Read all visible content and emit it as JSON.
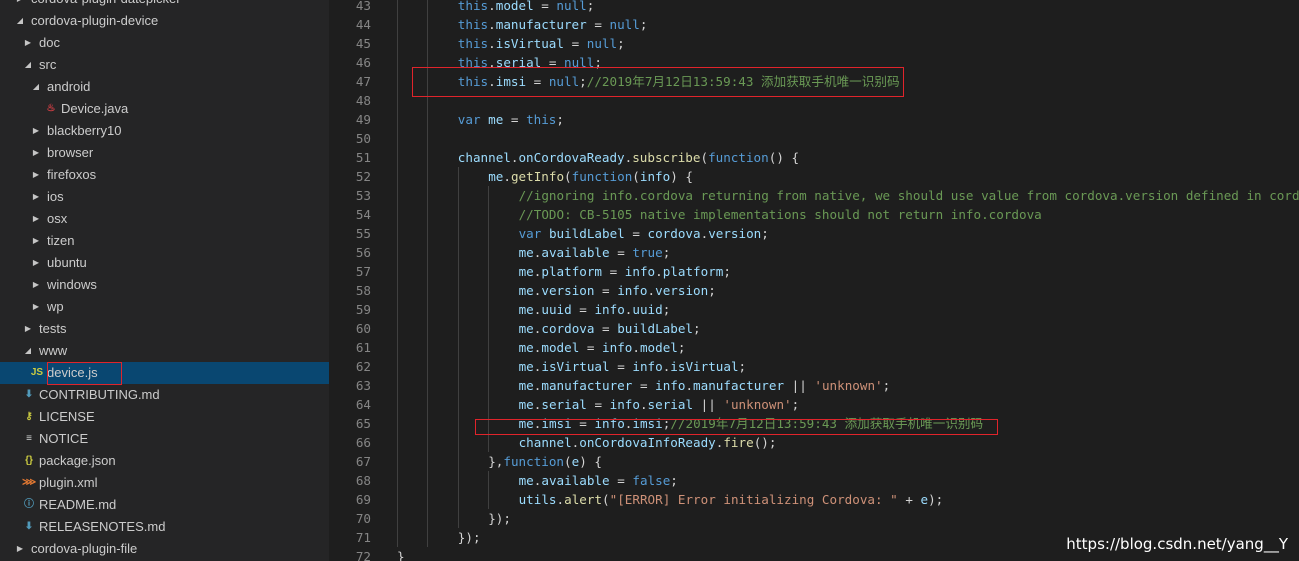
{
  "colors": {
    "sidebar_bg": "#252526",
    "editor_bg": "#1e1e1e",
    "selection": "#094771",
    "highlight_box": "#e0242b",
    "keyword": "#569cd6",
    "property": "#9cdcfe",
    "function": "#dcdcaa",
    "string": "#ce9178",
    "comment": "#6a9955"
  },
  "explorer": {
    "items": [
      {
        "label": "cordova-plugin-datepicker",
        "depth": 0,
        "twisty": "collapsed",
        "icon": ""
      },
      {
        "label": "cordova-plugin-device",
        "depth": 0,
        "twisty": "expanded",
        "icon": ""
      },
      {
        "label": "doc",
        "depth": 1,
        "twisty": "collapsed",
        "icon": ""
      },
      {
        "label": "src",
        "depth": 1,
        "twisty": "expanded",
        "icon": ""
      },
      {
        "label": "android",
        "depth": 2,
        "twisty": "expanded",
        "icon": ""
      },
      {
        "label": "Device.java",
        "depth": 3,
        "twisty": "none",
        "icon": "java-file-icon"
      },
      {
        "label": "blackberry10",
        "depth": 2,
        "twisty": "collapsed",
        "icon": ""
      },
      {
        "label": "browser",
        "depth": 2,
        "twisty": "collapsed",
        "icon": ""
      },
      {
        "label": "firefoxos",
        "depth": 2,
        "twisty": "collapsed",
        "icon": ""
      },
      {
        "label": "ios",
        "depth": 2,
        "twisty": "collapsed",
        "icon": ""
      },
      {
        "label": "osx",
        "depth": 2,
        "twisty": "collapsed",
        "icon": ""
      },
      {
        "label": "tizen",
        "depth": 2,
        "twisty": "collapsed",
        "icon": ""
      },
      {
        "label": "ubuntu",
        "depth": 2,
        "twisty": "collapsed",
        "icon": ""
      },
      {
        "label": "windows",
        "depth": 2,
        "twisty": "collapsed",
        "icon": ""
      },
      {
        "label": "wp",
        "depth": 2,
        "twisty": "collapsed",
        "icon": ""
      },
      {
        "label": "tests",
        "depth": 1,
        "twisty": "collapsed",
        "icon": ""
      },
      {
        "label": "www",
        "depth": 1,
        "twisty": "expanded",
        "icon": ""
      },
      {
        "label": "device.js",
        "depth": 2,
        "twisty": "none",
        "icon": "js-file-icon",
        "selected": true
      },
      {
        "label": "CONTRIBUTING.md",
        "depth": 1,
        "twisty": "none",
        "icon": "markdown-file-icon"
      },
      {
        "label": "LICENSE",
        "depth": 1,
        "twisty": "none",
        "icon": "license-file-icon"
      },
      {
        "label": "NOTICE",
        "depth": 1,
        "twisty": "none",
        "icon": "text-file-icon"
      },
      {
        "label": "package.json",
        "depth": 1,
        "twisty": "none",
        "icon": "json-file-icon"
      },
      {
        "label": "plugin.xml",
        "depth": 1,
        "twisty": "none",
        "icon": "xml-file-icon"
      },
      {
        "label": "README.md",
        "depth": 1,
        "twisty": "none",
        "icon": "info-file-icon"
      },
      {
        "label": "RELEASENOTES.md",
        "depth": 1,
        "twisty": "none",
        "icon": "markdown-file-icon"
      },
      {
        "label": "cordova-plugin-file",
        "depth": 0,
        "twisty": "collapsed",
        "icon": ""
      }
    ]
  },
  "editor": {
    "lines": [
      {
        "n": "43",
        "indent": 2,
        "t": [
          [
            "kw",
            "this"
          ],
          [
            "pl",
            "."
          ],
          [
            "prop",
            "model"
          ],
          [
            "pl",
            " = "
          ],
          [
            "kw",
            "null"
          ],
          [
            "pl",
            ";"
          ]
        ]
      },
      {
        "n": "44",
        "indent": 2,
        "t": [
          [
            "kw",
            "this"
          ],
          [
            "pl",
            "."
          ],
          [
            "prop",
            "manufacturer"
          ],
          [
            "pl",
            " = "
          ],
          [
            "kw",
            "null"
          ],
          [
            "pl",
            ";"
          ]
        ]
      },
      {
        "n": "45",
        "indent": 2,
        "t": [
          [
            "kw",
            "this"
          ],
          [
            "pl",
            "."
          ],
          [
            "prop",
            "isVirtual"
          ],
          [
            "pl",
            " = "
          ],
          [
            "kw",
            "null"
          ],
          [
            "pl",
            ";"
          ]
        ]
      },
      {
        "n": "46",
        "indent": 2,
        "t": [
          [
            "kw",
            "this"
          ],
          [
            "pl",
            "."
          ],
          [
            "prop",
            "serial"
          ],
          [
            "pl",
            " = "
          ],
          [
            "kw",
            "null"
          ],
          [
            "pl",
            ";"
          ]
        ]
      },
      {
        "n": "47",
        "indent": 2,
        "t": [
          [
            "kw",
            "this"
          ],
          [
            "pl",
            "."
          ],
          [
            "prop",
            "imsi"
          ],
          [
            "pl",
            " = "
          ],
          [
            "kw",
            "null"
          ],
          [
            "pl",
            ";"
          ],
          [
            "com",
            "//2019年7月12日13:59:43 添加获取手机唯一识别码"
          ]
        ]
      },
      {
        "n": "48",
        "indent": 2,
        "t": []
      },
      {
        "n": "49",
        "indent": 2,
        "t": [
          [
            "kw",
            "var"
          ],
          [
            "pl",
            " "
          ],
          [
            "prop",
            "me"
          ],
          [
            "pl",
            " = "
          ],
          [
            "kw",
            "this"
          ],
          [
            "pl",
            ";"
          ]
        ]
      },
      {
        "n": "50",
        "indent": 2,
        "t": []
      },
      {
        "n": "51",
        "indent": 2,
        "t": [
          [
            "prop",
            "channel"
          ],
          [
            "pl",
            "."
          ],
          [
            "prop",
            "onCordovaReady"
          ],
          [
            "pl",
            "."
          ],
          [
            "fn",
            "subscribe"
          ],
          [
            "pl",
            "("
          ],
          [
            "kw",
            "function"
          ],
          [
            "pl",
            "() {"
          ]
        ]
      },
      {
        "n": "52",
        "indent": 3,
        "t": [
          [
            "prop",
            "me"
          ],
          [
            "pl",
            "."
          ],
          [
            "fn",
            "getInfo"
          ],
          [
            "pl",
            "("
          ],
          [
            "kw",
            "function"
          ],
          [
            "pl",
            "("
          ],
          [
            "prop",
            "info"
          ],
          [
            "pl",
            ") {"
          ]
        ]
      },
      {
        "n": "53",
        "indent": 4,
        "t": [
          [
            "com",
            "//ignoring info.cordova returning from native, we should use value from cordova.version defined in cordova.js"
          ]
        ]
      },
      {
        "n": "54",
        "indent": 4,
        "t": [
          [
            "com",
            "//TODO: CB-5105 native implementations should not return info.cordova"
          ]
        ]
      },
      {
        "n": "55",
        "indent": 4,
        "t": [
          [
            "kw",
            "var"
          ],
          [
            "pl",
            " "
          ],
          [
            "prop",
            "buildLabel"
          ],
          [
            "pl",
            " = "
          ],
          [
            "prop",
            "cordova"
          ],
          [
            "pl",
            "."
          ],
          [
            "prop",
            "version"
          ],
          [
            "pl",
            ";"
          ]
        ]
      },
      {
        "n": "56",
        "indent": 4,
        "t": [
          [
            "prop",
            "me"
          ],
          [
            "pl",
            "."
          ],
          [
            "prop",
            "available"
          ],
          [
            "pl",
            " = "
          ],
          [
            "kw",
            "true"
          ],
          [
            "pl",
            ";"
          ]
        ]
      },
      {
        "n": "57",
        "indent": 4,
        "t": [
          [
            "prop",
            "me"
          ],
          [
            "pl",
            "."
          ],
          [
            "prop",
            "platform"
          ],
          [
            "pl",
            " = "
          ],
          [
            "prop",
            "info"
          ],
          [
            "pl",
            "."
          ],
          [
            "prop",
            "platform"
          ],
          [
            "pl",
            ";"
          ]
        ]
      },
      {
        "n": "58",
        "indent": 4,
        "t": [
          [
            "prop",
            "me"
          ],
          [
            "pl",
            "."
          ],
          [
            "prop",
            "version"
          ],
          [
            "pl",
            " = "
          ],
          [
            "prop",
            "info"
          ],
          [
            "pl",
            "."
          ],
          [
            "prop",
            "version"
          ],
          [
            "pl",
            ";"
          ]
        ]
      },
      {
        "n": "59",
        "indent": 4,
        "t": [
          [
            "prop",
            "me"
          ],
          [
            "pl",
            "."
          ],
          [
            "prop",
            "uuid"
          ],
          [
            "pl",
            " = "
          ],
          [
            "prop",
            "info"
          ],
          [
            "pl",
            "."
          ],
          [
            "prop",
            "uuid"
          ],
          [
            "pl",
            ";"
          ]
        ]
      },
      {
        "n": "60",
        "indent": 4,
        "t": [
          [
            "prop",
            "me"
          ],
          [
            "pl",
            "."
          ],
          [
            "prop",
            "cordova"
          ],
          [
            "pl",
            " = "
          ],
          [
            "prop",
            "buildLabel"
          ],
          [
            "pl",
            ";"
          ]
        ]
      },
      {
        "n": "61",
        "indent": 4,
        "t": [
          [
            "prop",
            "me"
          ],
          [
            "pl",
            "."
          ],
          [
            "prop",
            "model"
          ],
          [
            "pl",
            " = "
          ],
          [
            "prop",
            "info"
          ],
          [
            "pl",
            "."
          ],
          [
            "prop",
            "model"
          ],
          [
            "pl",
            ";"
          ]
        ]
      },
      {
        "n": "62",
        "indent": 4,
        "t": [
          [
            "prop",
            "me"
          ],
          [
            "pl",
            "."
          ],
          [
            "prop",
            "isVirtual"
          ],
          [
            "pl",
            " = "
          ],
          [
            "prop",
            "info"
          ],
          [
            "pl",
            "."
          ],
          [
            "prop",
            "isVirtual"
          ],
          [
            "pl",
            ";"
          ]
        ]
      },
      {
        "n": "63",
        "indent": 4,
        "t": [
          [
            "prop",
            "me"
          ],
          [
            "pl",
            "."
          ],
          [
            "prop",
            "manufacturer"
          ],
          [
            "pl",
            " = "
          ],
          [
            "prop",
            "info"
          ],
          [
            "pl",
            "."
          ],
          [
            "prop",
            "manufacturer"
          ],
          [
            "pl",
            " || "
          ],
          [
            "str",
            "'unknown'"
          ],
          [
            "pl",
            ";"
          ]
        ]
      },
      {
        "n": "64",
        "indent": 4,
        "t": [
          [
            "prop",
            "me"
          ],
          [
            "pl",
            "."
          ],
          [
            "prop",
            "serial"
          ],
          [
            "pl",
            " = "
          ],
          [
            "prop",
            "info"
          ],
          [
            "pl",
            "."
          ],
          [
            "prop",
            "serial"
          ],
          [
            "pl",
            " || "
          ],
          [
            "str",
            "'unknown'"
          ],
          [
            "pl",
            ";"
          ]
        ]
      },
      {
        "n": "65",
        "indent": 4,
        "t": [
          [
            "prop",
            "me"
          ],
          [
            "pl",
            "."
          ],
          [
            "prop",
            "imsi"
          ],
          [
            "pl",
            " = "
          ],
          [
            "prop",
            "info"
          ],
          [
            "pl",
            "."
          ],
          [
            "prop",
            "imsi"
          ],
          [
            "pl",
            ";"
          ],
          [
            "com",
            "//2019年7月12日13:59:43 添加获取手机唯一识别码"
          ]
        ]
      },
      {
        "n": "66",
        "indent": 4,
        "t": [
          [
            "prop",
            "channel"
          ],
          [
            "pl",
            "."
          ],
          [
            "prop",
            "onCordovaInfoReady"
          ],
          [
            "pl",
            "."
          ],
          [
            "fn",
            "fire"
          ],
          [
            "pl",
            "();"
          ]
        ]
      },
      {
        "n": "67",
        "indent": 3,
        "t": [
          [
            "pl",
            "},"
          ],
          [
            "kw",
            "function"
          ],
          [
            "pl",
            "("
          ],
          [
            "prop",
            "e"
          ],
          [
            "pl",
            ") {"
          ]
        ]
      },
      {
        "n": "68",
        "indent": 4,
        "t": [
          [
            "prop",
            "me"
          ],
          [
            "pl",
            "."
          ],
          [
            "prop",
            "available"
          ],
          [
            "pl",
            " = "
          ],
          [
            "kw",
            "false"
          ],
          [
            "pl",
            ";"
          ]
        ]
      },
      {
        "n": "69",
        "indent": 4,
        "t": [
          [
            "prop",
            "utils"
          ],
          [
            "pl",
            "."
          ],
          [
            "fn",
            "alert"
          ],
          [
            "pl",
            "("
          ],
          [
            "str",
            "\"[ERROR] Error initializing Cordova: \""
          ],
          [
            "pl",
            " + "
          ],
          [
            "prop",
            "e"
          ],
          [
            "pl",
            ");"
          ]
        ]
      },
      {
        "n": "70",
        "indent": 3,
        "t": [
          [
            "pl",
            "});"
          ]
        ]
      },
      {
        "n": "71",
        "indent": 2,
        "t": [
          [
            "pl",
            "});"
          ]
        ]
      },
      {
        "n": "72",
        "indent": 0,
        "t": [
          [
            "pl",
            "}"
          ]
        ]
      }
    ]
  },
  "watermark": "https://blog.csdn.net/yang__Y"
}
